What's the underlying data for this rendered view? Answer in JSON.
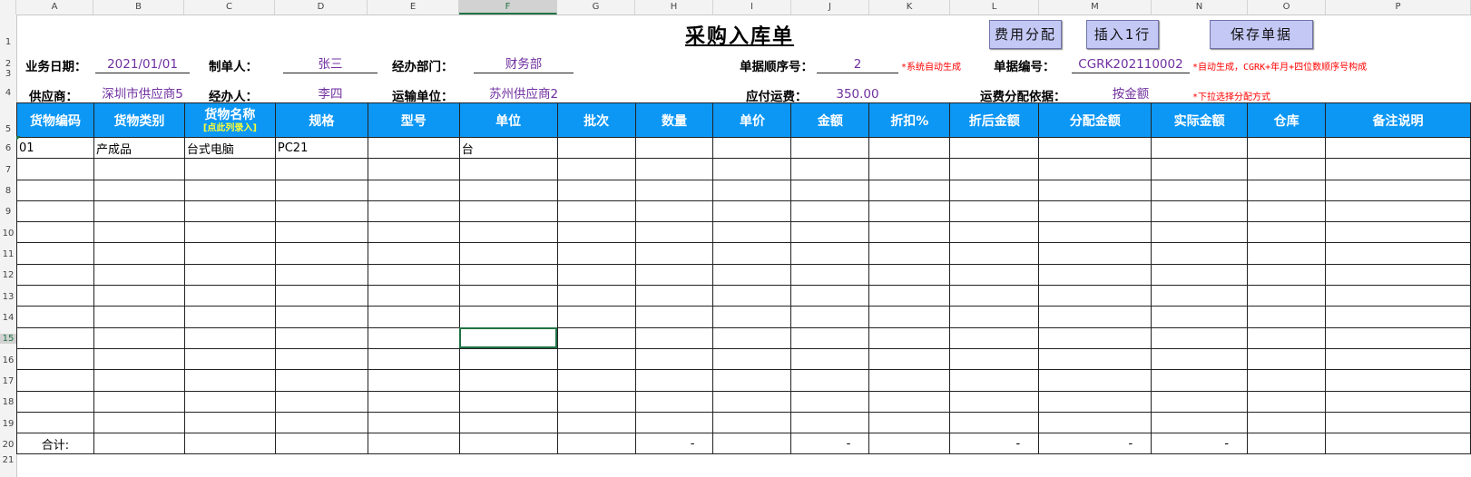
{
  "columns": [
    "A",
    "B",
    "C",
    "D",
    "E",
    "F",
    "G",
    "H",
    "I",
    "J",
    "K",
    "L",
    "M",
    "N",
    "O",
    "P"
  ],
  "selected_column": "F",
  "rows": [
    "1",
    "2",
    "3",
    "4",
    "5",
    "6",
    "7",
    "8",
    "9",
    "10",
    "11",
    "12",
    "13",
    "14",
    "15",
    "16",
    "17",
    "18",
    "19",
    "20",
    "21"
  ],
  "selected_row": "15",
  "title": "采购入库单",
  "buttons": {
    "allocate": "费用分配",
    "insert_row": "插入1行",
    "save": "保存单据"
  },
  "header": {
    "biz_date_label": "业务日期：",
    "biz_date": "2021/01/01",
    "maker_label": "制单人：",
    "maker": "张三",
    "dept_label": "经办部门：",
    "dept": "财务部",
    "seq_label": "单据顺序号：",
    "seq": "2",
    "seq_note": "*系统自动生成",
    "docno_label": "单据编号：",
    "docno": "CGRK202110002",
    "docno_note": "*自动生成，CGRK+年月+四位数顺序号构成",
    "supplier_label": "供应商：",
    "supplier": "深圳市供应商5",
    "handler_label": "经办人：",
    "handler": "李四",
    "carrier_label": "运输单位：",
    "carrier": "苏州供应商2",
    "freight_label": "应付运费：",
    "freight": "350.00",
    "basis_label": "运费分配依据：",
    "basis": "按金额",
    "basis_note": "*下拉选择分配方式"
  },
  "table": {
    "headers": [
      "货物编码",
      "货物类别",
      "货物名称",
      "规格",
      "型号",
      "单位",
      "批次",
      "数量",
      "单价",
      "金额",
      "折扣%",
      "折后金额",
      "分配金额",
      "实际金额",
      "仓库",
      "备注说明"
    ],
    "name_hint": "[点此列录入]",
    "rows": [
      [
        "01",
        "产成品",
        "台式电脑",
        "PC21",
        "",
        "台",
        "",
        "",
        "",
        "",
        "",
        "",
        "",
        "",
        "",
        ""
      ]
    ],
    "total_label": "合计:",
    "totals": [
      "",
      "",
      "",
      "",
      "",
      "",
      "",
      "-",
      "",
      "-",
      "",
      "-",
      "-",
      "-",
      "",
      ""
    ]
  },
  "colors": {
    "header_bg": "#0c97f5",
    "accent_purple": "#7030a0",
    "note_red": "#ff0000",
    "button_bg": "#c4c8f5"
  }
}
